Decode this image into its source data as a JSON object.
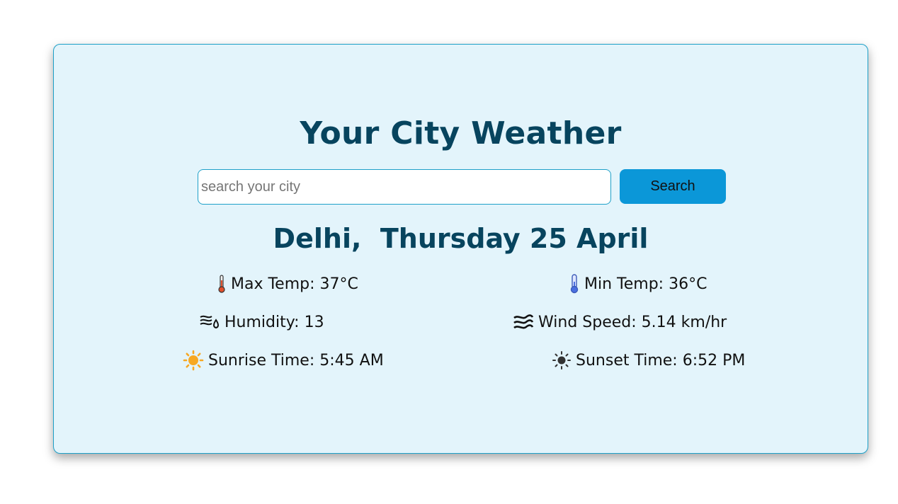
{
  "app": {
    "title": "Your City Weather",
    "brand_color": "#07445e",
    "accent_color": "#0b97d8",
    "card_background": "#e3f4fb"
  },
  "search": {
    "placeholder": "search your city",
    "value": "",
    "button_label": "Search"
  },
  "location": {
    "city": "Delhi,",
    "date": "Thursday 25 April"
  },
  "stats": {
    "max_temp": {
      "label": "Max Temp:",
      "value": "37°C",
      "icon": "thermometer-hot-icon"
    },
    "min_temp": {
      "label": "Min Temp:",
      "value": "36°C",
      "icon": "thermometer-cold-icon"
    },
    "humidity": {
      "label": "Humidity:",
      "value": "13",
      "icon": "humidity-wind-icon"
    },
    "wind_speed": {
      "label": "Wind Speed:",
      "value": "5.14 km/hr",
      "icon": "wind-waves-icon"
    },
    "sunrise": {
      "label": "Sunrise Time:",
      "value": "5:45 AM",
      "icon": "sun-icon"
    },
    "sunset": {
      "label": "Sunset Time:",
      "value": "6:52 PM",
      "icon": "sun-outline-icon"
    }
  }
}
